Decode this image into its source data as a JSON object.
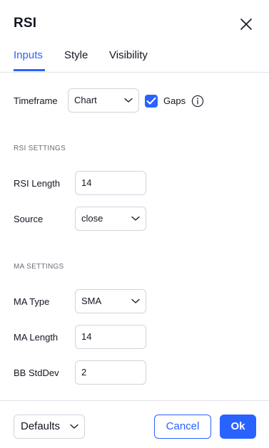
{
  "dialog": {
    "title": "RSI",
    "close_icon": "close-icon"
  },
  "tabs": [
    {
      "label": "Inputs",
      "active": true
    },
    {
      "label": "Style",
      "active": false
    },
    {
      "label": "Visibility",
      "active": false
    }
  ],
  "timeframe": {
    "label": "Timeframe",
    "value": "Chart",
    "gaps_label": "Gaps",
    "gaps_checked": true
  },
  "rsi_settings": {
    "heading": "RSI SETTINGS",
    "length_label": "RSI Length",
    "length_value": "14",
    "source_label": "Source",
    "source_value": "close"
  },
  "ma_settings": {
    "heading": "MA SETTINGS",
    "type_label": "MA Type",
    "type_value": "SMA",
    "length_label": "MA Length",
    "length_value": "14",
    "bb_label": "BB StdDev",
    "bb_value": "2"
  },
  "footer": {
    "defaults_label": "Defaults",
    "cancel_label": "Cancel",
    "ok_label": "Ok"
  },
  "colors": {
    "accent": "#2962ff",
    "text": "#131722",
    "muted": "#6a6d78",
    "border": "#d1d4dc"
  }
}
